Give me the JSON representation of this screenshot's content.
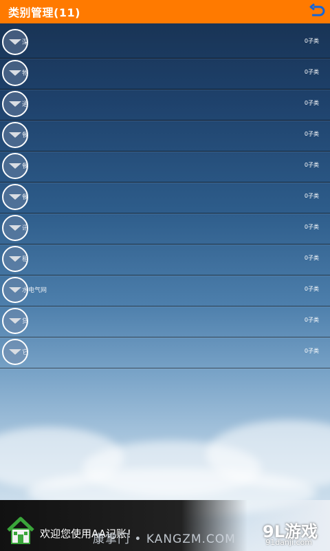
{
  "header": {
    "title": "类别管理(11)",
    "back_icon": "undo-arrow-icon",
    "accent_color": "#ff7a00"
  },
  "categories": [
    {
      "label": "深",
      "count": "0子类"
    },
    {
      "label": "物",
      "count": "0子类"
    },
    {
      "label": "通",
      "count": "0子类"
    },
    {
      "label": "餐",
      "count": "0子类"
    },
    {
      "label": "餐",
      "count": "0子类"
    },
    {
      "label": "餐",
      "count": "0子类"
    },
    {
      "label": "讯",
      "count": "0子类"
    },
    {
      "label": "租",
      "count": "0子类"
    },
    {
      "label": "水电气网",
      "count": "0子类"
    },
    {
      "label": "贷",
      "count": "0子类"
    },
    {
      "label": "它",
      "count": "0子类"
    }
  ],
  "footer": {
    "welcome_text": "欢迎您使用AA记账！",
    "home_icon": "house-icon",
    "watermark_center": "康掌门 • KANGZM.COM",
    "watermark_logo": "9L游戏",
    "watermark_domain": "91danji.com"
  }
}
